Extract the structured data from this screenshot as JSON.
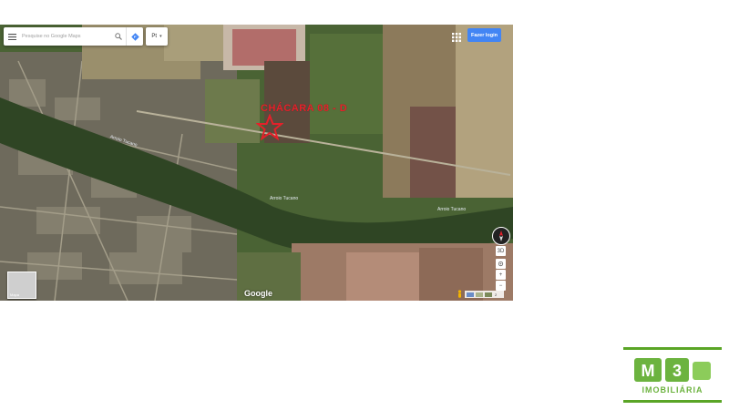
{
  "map": {
    "search_placeholder": "Pesquise no Google Maps",
    "lang_selected": "Pt",
    "login_label": "Fazer login",
    "pin_label": "CHÁCARA 08 - D",
    "road_labels": [
      "Arroio Tucano",
      "Arroio Tucano",
      "Arroio Tucano"
    ],
    "thumb_label": "Mapa",
    "brand": "Google",
    "scale_text": "2"
  },
  "logo": {
    "mark": "M3",
    "name": "IMOBILIÁRIA",
    "accent": "#5aa526"
  },
  "colors": {
    "pin": "#e5202a",
    "login_button": "#4285f4"
  }
}
